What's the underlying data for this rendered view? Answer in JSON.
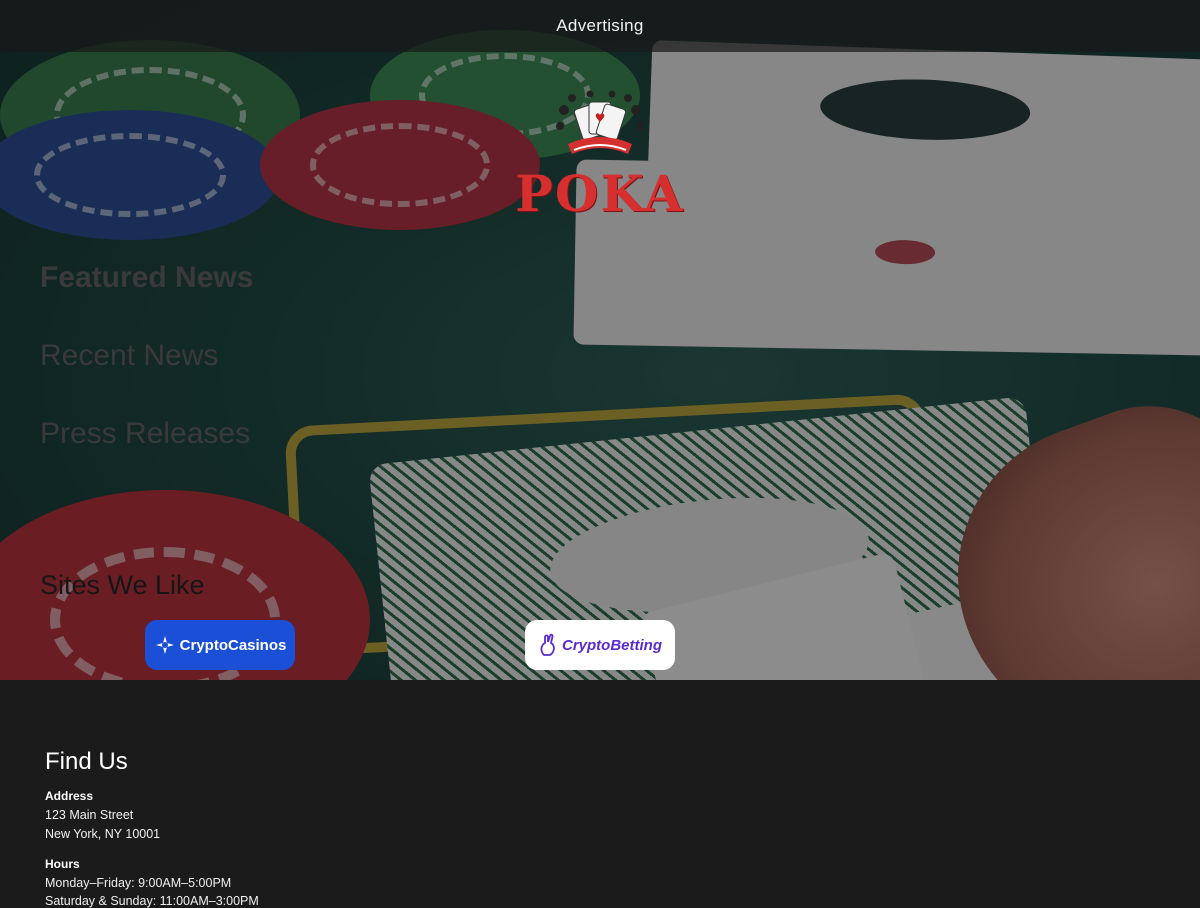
{
  "topbar": {
    "label": "Advertising"
  },
  "logo": {
    "text": "POKA",
    "icon": "playing-cards-emblem"
  },
  "nav": {
    "items": [
      {
        "label": "Featured News"
      },
      {
        "label": "Recent News"
      },
      {
        "label": "Press Releases"
      }
    ]
  },
  "sites": {
    "title": "Sites We Like",
    "items": [
      {
        "label": "CryptoCasinos",
        "icon": "crypto-casinos-icon",
        "color": "#1a4fd6"
      },
      {
        "label": "CryptoBetting",
        "icon": "crypto-betting-icon",
        "color": "#5a2bd0"
      }
    ]
  },
  "footer": {
    "title": "Find Us",
    "address_label": "Address",
    "address_line1": "123 Main Street",
    "address_line2": "New York, NY 10001",
    "hours_label": "Hours",
    "hours_line1": "Monday–Friday: 9:00AM–5:00PM",
    "hours_line2": "Saturday & Sunday: 11:00AM–3:00PM"
  },
  "colors": {
    "logo_red": "#d62f2f",
    "footer_bg": "#1b1b1b"
  }
}
